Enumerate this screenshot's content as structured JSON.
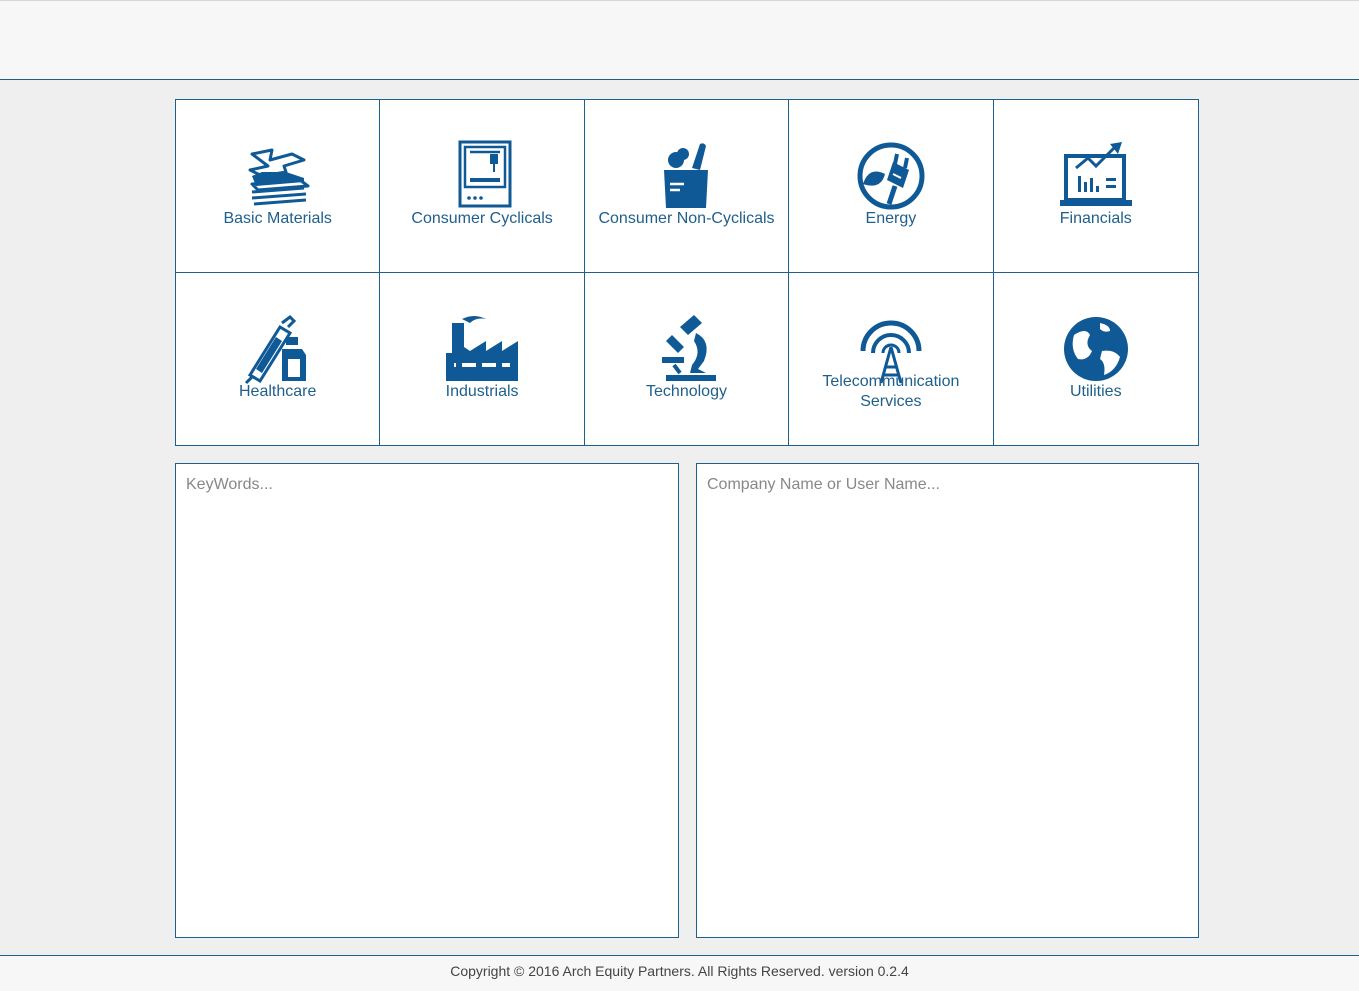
{
  "colors": {
    "accent": "#1f5f8b",
    "icon": "#0f5a96",
    "page_bg": "#efefef"
  },
  "sectors": [
    {
      "label": "Basic Materials",
      "icon": "stacked-sheets-icon"
    },
    {
      "label": "Consumer Cyclicals",
      "icon": "printer-machine-icon"
    },
    {
      "label": "Consumer Non-Cyclicals",
      "icon": "grocery-bag-icon"
    },
    {
      "label": "Energy",
      "icon": "plug-leaf-icon"
    },
    {
      "label": "Financials",
      "icon": "laptop-chart-icon"
    },
    {
      "label": "Healthcare",
      "icon": "syringe-bottle-icon"
    },
    {
      "label": "Industrials",
      "icon": "factory-icon"
    },
    {
      "label": "Technology",
      "icon": "microscope-icon"
    },
    {
      "label": "Telecommunication Services",
      "icon": "antenna-tower-icon"
    },
    {
      "label": "Utilities",
      "icon": "globe-icon"
    }
  ],
  "search": {
    "keywords_placeholder": "KeyWords...",
    "keywords_value": "",
    "company_placeholder": "Company Name or User Name...",
    "company_value": ""
  },
  "footer": {
    "text": "Copyright © 2016 Arch Equity Partners. All Rights Reserved. version 0.2.4"
  }
}
